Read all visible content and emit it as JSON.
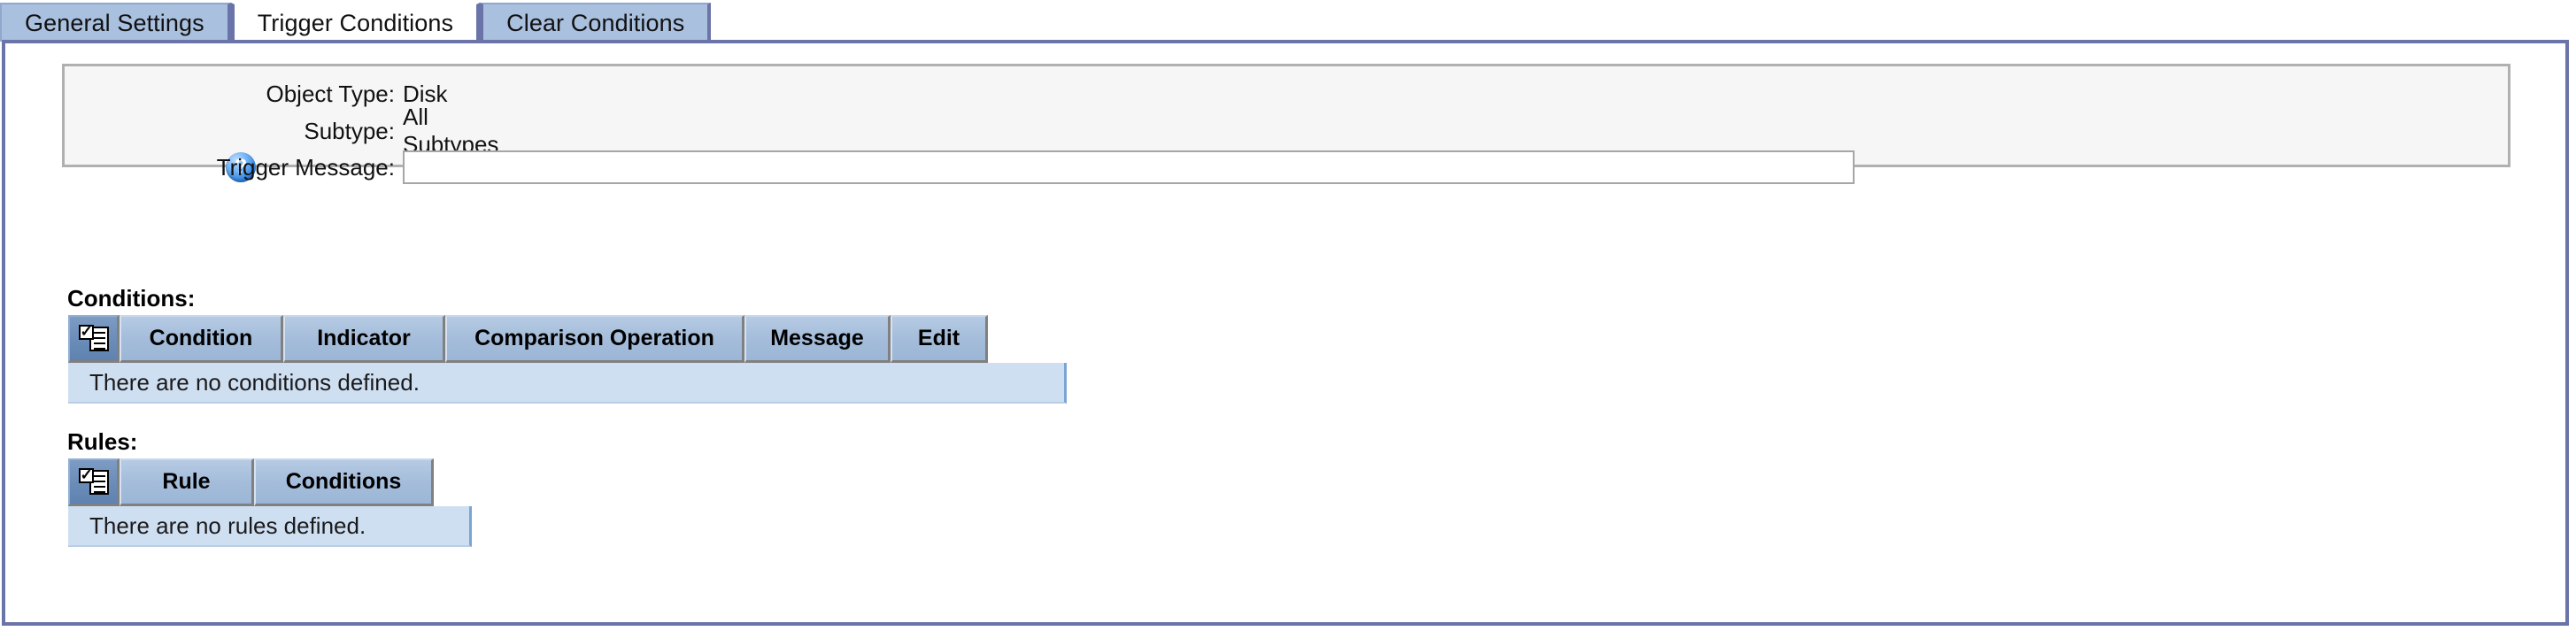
{
  "tabs": [
    {
      "label": "General Settings",
      "active": false
    },
    {
      "label": "Trigger Conditions",
      "active": true
    },
    {
      "label": "Clear Conditions",
      "active": false
    }
  ],
  "info_panel": {
    "object_type_label": "Object Type:",
    "object_type_value": "Disk",
    "subtype_label": "Subtype:",
    "subtype_value": "All Subtypes",
    "trigger_message_label": "Trigger Message:",
    "trigger_message_value": "",
    "trigger_message_placeholder": "",
    "help_icon": "help-question-icon",
    "help_icon_glyph": "?"
  },
  "conditions_section": {
    "label": "Conditions:",
    "select_icon": "select-all-list-icon",
    "columns": [
      "Condition",
      "Indicator",
      "Comparison Operation",
      "Message",
      "Edit"
    ],
    "rows": [],
    "empty_text": "There are no conditions defined."
  },
  "rules_section": {
    "label": "Rules:",
    "select_icon": "select-all-list-icon",
    "columns": [
      "Rule",
      "Conditions"
    ],
    "rows": [],
    "empty_text": "There are no rules defined."
  },
  "colors": {
    "tab_inactive": "#a9c0de",
    "tab_border": "#6b74a8",
    "frame_border": "#6b74a8",
    "panel_bg": "#f6f6f6",
    "panel_border": "#b0b0b0",
    "header_cell": "#a3bcda",
    "header_icon_cell": "#6a8cb8",
    "empty_row_bg": "#cfdff2"
  }
}
